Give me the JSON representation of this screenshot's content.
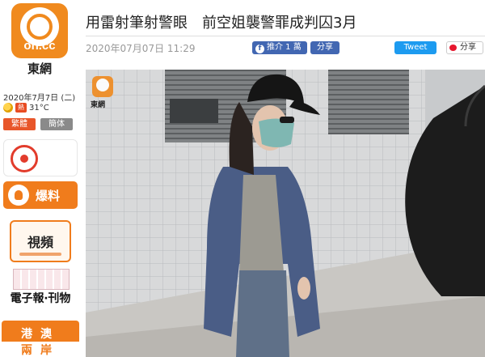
{
  "site": {
    "logo_text": "on.cc",
    "name": "東網"
  },
  "sidebar": {
    "date": "2020年7月7日 (二)",
    "weather_badge": "熱",
    "temperature": "31°C",
    "lang_traditional": "繁體",
    "lang_simplified": "簡体",
    "tipoff_label": "爆料",
    "video_label": "視頻",
    "epaper_label": "電子報‧刊物",
    "hk_macau_line1": "港澳",
    "hk_macau_line2": "兩岸"
  },
  "article": {
    "headline": "用雷射筆射警眼　前空姐襲警罪成判囚3月",
    "timestamp": "2020年07月07日 11:29",
    "fb_like": "推介 1 萬",
    "fb_share": "分享",
    "tweet": "Tweet",
    "weibo_share": "分享"
  },
  "photo": {
    "watermark_name": "東網"
  }
}
